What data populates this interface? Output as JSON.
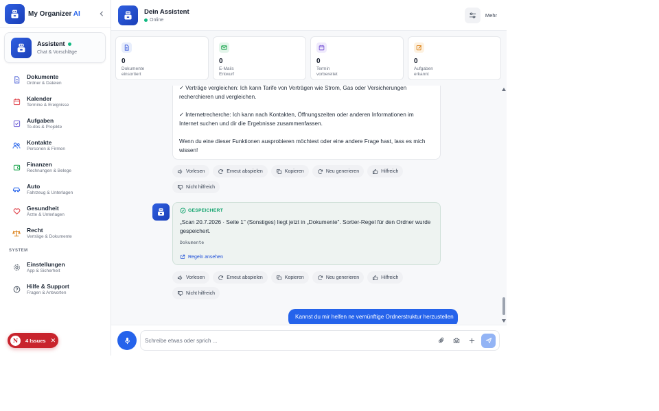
{
  "app": {
    "brand_main": "My Organizer",
    "brand_ai": "AI",
    "collapse_icon": "chevron-left-icon"
  },
  "assistant_card": {
    "title": "Assistent",
    "subtitle": "Chat & Vorschläge",
    "status_color": "#10b981"
  },
  "nav": {
    "items": [
      {
        "label": "Dokumente",
        "sub": "Ordner & Dateien",
        "icon": "document-icon",
        "color": "#4f63d6"
      },
      {
        "label": "Kalender",
        "sub": "Termine & Ereignisse",
        "icon": "calendar-icon",
        "color": "#e0464e"
      },
      {
        "label": "Aufgaben",
        "sub": "To-dos & Projekte",
        "icon": "checkbox-icon",
        "color": "#6b5bd6"
      },
      {
        "label": "Kontakte",
        "sub": "Personen & Firmen",
        "icon": "contacts-icon",
        "color": "#2563eb"
      },
      {
        "label": "Finanzen",
        "sub": "Rechnungen & Belege",
        "icon": "wallet-icon",
        "color": "#16a34a"
      },
      {
        "label": "Auto",
        "sub": "Fahrzeug & Unterlagen",
        "icon": "car-icon",
        "color": "#2563eb"
      },
      {
        "label": "Gesundheit",
        "sub": "Ärzte & Unterlagen",
        "icon": "heart-icon",
        "color": "#e0464e"
      },
      {
        "label": "Recht",
        "sub": "Verträge & Dokumente",
        "icon": "scales-icon",
        "color": "#d97706"
      }
    ],
    "section_system": "SYSTEM",
    "system_items": [
      {
        "label": "Einstellungen",
        "sub": "App & Sicherheit",
        "icon": "gear-icon",
        "color": "#4b5563"
      },
      {
        "label": "Hilfe & Support",
        "sub": "Fragen & Antworten",
        "icon": "help-icon",
        "color": "#4b5563"
      }
    ]
  },
  "issues": {
    "badge": "N",
    "label": "4 Issues",
    "close": "✕",
    "color": "#c8232c"
  },
  "header": {
    "title": "Dein Assistent",
    "status": "Online",
    "more_label": "Mehr"
  },
  "stats": [
    {
      "value": "0",
      "line1": "Dokumente",
      "line2": "einsortiert",
      "icon": "document-icon",
      "color": "#3b5bdb",
      "bg": "#e8eefc"
    },
    {
      "value": "0",
      "line1": "E-Mails",
      "line2": "Entwurf",
      "icon": "mail-icon",
      "color": "#16a34a",
      "bg": "#e3f5ea"
    },
    {
      "value": "0",
      "line1": "Termin",
      "line2": "vorbereitet",
      "icon": "calendar-icon",
      "color": "#7c5bd6",
      "bg": "#efeafc"
    },
    {
      "value": "0",
      "line1": "Aufgaben",
      "line2": "erkannt",
      "icon": "edit-icon",
      "color": "#d97706",
      "bg": "#fdf1e0"
    }
  ],
  "chat": {
    "message1": {
      "line_partial": "✓ Verträge vergleichen: Ich kann Tarife von Verträgen wie Strom, Gas oder Versicherungen recherchieren und vergleichen.",
      "line_research": "✓ Internetrecherche: Ich kann nach Kontakten, Öffnungszeiten oder anderen Informationen im Internet suchen und dir die Ergebnisse zusammenfassen.",
      "line_closing": "Wenn du eine dieser Funktionen ausprobieren möchtest oder eine andere Frage hast, lass es mich wissen!"
    },
    "actions": {
      "read": "Vorlesen",
      "replay": "Erneut abspielen",
      "copy": "Kopieren",
      "regenerate": "Neu generieren",
      "helpful": "Hilfreich",
      "not_helpful": "Nicht hilfreich"
    },
    "saved": {
      "tag": "GESPEICHERT",
      "text": "„Scan 20.7.2026 · Seite 1\" (Sonstiges) liegt jetzt in „Dokumente\". Sortier-Regel für den Ordner wurde gespeichert.",
      "folder": "Dokumente",
      "link": "Regeln ansehen"
    },
    "user_message": "Kannst du mir helfen ne vernünftige Ordnerstruktur herzustellen"
  },
  "composer": {
    "placeholder": "Schreibe etwas oder sprich ...",
    "value": ""
  }
}
